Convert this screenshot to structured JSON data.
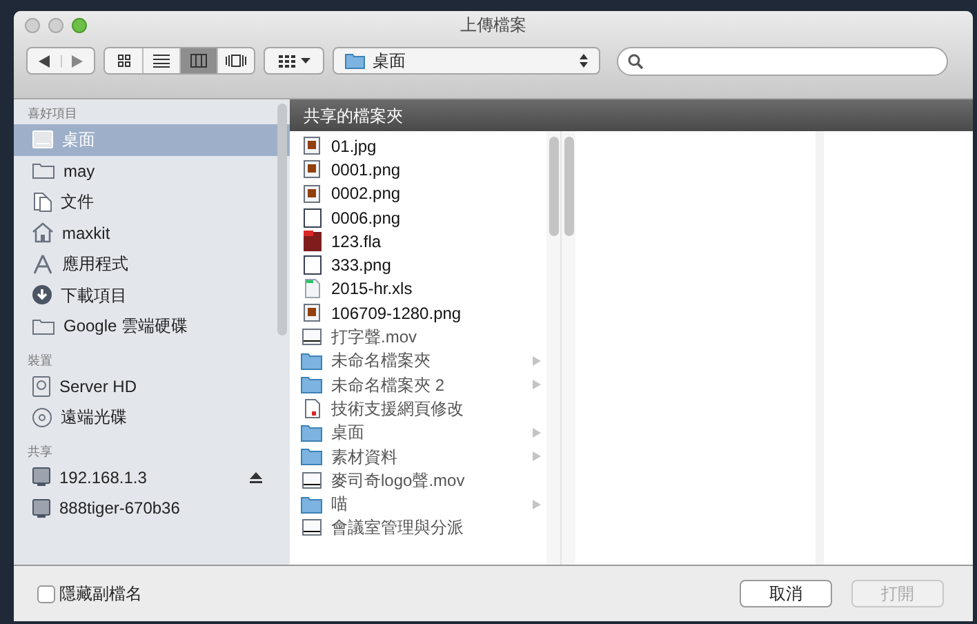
{
  "window": {
    "title": "上傳檔案"
  },
  "toolbar": {
    "view_modes": [
      {
        "kind": "icons",
        "selected": false
      },
      {
        "kind": "list",
        "selected": false
      },
      {
        "kind": "columns",
        "selected": true
      },
      {
        "kind": "coverflow",
        "selected": false
      }
    ],
    "location": "桌面"
  },
  "sidebar": {
    "sections": [
      {
        "heading": "喜好項目",
        "items": [
          {
            "label": "桌面",
            "kind": "desktop",
            "selected": true,
            "ejectable": false
          },
          {
            "label": "may",
            "kind": "folder",
            "selected": false,
            "ejectable": false
          },
          {
            "label": "文件",
            "kind": "documents",
            "selected": false,
            "ejectable": false
          },
          {
            "label": "maxkit",
            "kind": "home",
            "selected": false,
            "ejectable": false
          },
          {
            "label": "應用程式",
            "kind": "apps",
            "selected": false,
            "ejectable": false
          },
          {
            "label": "下載項目",
            "kind": "download",
            "selected": false,
            "ejectable": false
          },
          {
            "label": "Google 雲端硬碟",
            "kind": "folder",
            "selected": false,
            "ejectable": false
          }
        ]
      },
      {
        "heading": "裝置",
        "items": [
          {
            "label": "Server HD",
            "kind": "disk",
            "selected": false,
            "ejectable": false
          },
          {
            "label": "遠端光碟",
            "kind": "disc",
            "selected": false,
            "ejectable": false
          }
        ]
      },
      {
        "heading": "共享",
        "items": [
          {
            "label": "192.168.1.3",
            "kind": "server",
            "selected": false,
            "ejectable": true
          },
          {
            "label": "888tiger-670b36",
            "kind": "server",
            "selected": false,
            "ejectable": false
          }
        ]
      }
    ]
  },
  "browser": {
    "header": "共享的檔案夾",
    "files": [
      {
        "name": "01.jpg",
        "kind": "image",
        "disabled": false,
        "has_children": false
      },
      {
        "name": "0001.png",
        "kind": "image",
        "disabled": false,
        "has_children": false
      },
      {
        "name": "0002.png",
        "kind": "image",
        "disabled": false,
        "has_children": false
      },
      {
        "name": "0006.png",
        "kind": "blank",
        "disabled": false,
        "has_children": false
      },
      {
        "name": "123.fla",
        "kind": "flash",
        "disabled": false,
        "has_children": false
      },
      {
        "name": "333.png",
        "kind": "blank",
        "disabled": false,
        "has_children": false
      },
      {
        "name": "2015-hr.xls",
        "kind": "sheet",
        "disabled": false,
        "has_children": false
      },
      {
        "name": "106709-1280.png",
        "kind": "image",
        "disabled": false,
        "has_children": false
      },
      {
        "name": "打字聲.mov",
        "kind": "movie",
        "disabled": true,
        "has_children": false
      },
      {
        "name": "未命名檔案夾",
        "kind": "folder",
        "disabled": true,
        "has_children": true
      },
      {
        "name": "未命名檔案夾 2",
        "kind": "folder",
        "disabled": true,
        "has_children": true
      },
      {
        "name": "技術支援網頁修改",
        "kind": "document",
        "disabled": true,
        "has_children": false
      },
      {
        "name": "桌面",
        "kind": "folder",
        "disabled": true,
        "has_children": true
      },
      {
        "name": "素材資料",
        "kind": "folder",
        "disabled": true,
        "has_children": true
      },
      {
        "name": "麥司奇logo聲.mov",
        "kind": "movie",
        "disabled": true,
        "has_children": false
      },
      {
        "name": "喵",
        "kind": "folder",
        "disabled": true,
        "has_children": true
      },
      {
        "name": "會議室管理與分派",
        "kind": "movie",
        "disabled": true,
        "has_children": false
      }
    ]
  },
  "footer": {
    "hide_extension": {
      "label": "隱藏副檔名",
      "checked": false
    },
    "buttons": [
      {
        "label": "取消",
        "disabled": false
      },
      {
        "label": "打開",
        "disabled": true
      }
    ]
  }
}
